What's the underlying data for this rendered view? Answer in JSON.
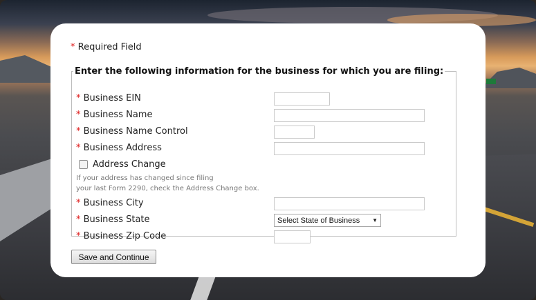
{
  "required_note": "Required Field",
  "required_marker": "*",
  "fieldset": {
    "legend": "Enter the following information for the business for which you are filing:"
  },
  "fields": {
    "ein": {
      "label": "Business EIN",
      "value": ""
    },
    "name": {
      "label": "Business Name",
      "value": ""
    },
    "name_control": {
      "label": "Business Name Control",
      "value": ""
    },
    "address": {
      "label": "Business Address",
      "value": ""
    },
    "address_change": {
      "label": "Address Change",
      "checked": false,
      "help_line1": "If your address has changed since filing",
      "help_line2": "your last Form 2290, check the Address Change box."
    },
    "city": {
      "label": "Business City",
      "value": ""
    },
    "state": {
      "label": "Business State",
      "selected": "Select State of Business"
    },
    "zip": {
      "label": "Business Zip Code",
      "value": ""
    }
  },
  "submit_label": "Save and Continue",
  "colors": {
    "required_star": "#dd1111",
    "card_background": "#ffffff"
  }
}
